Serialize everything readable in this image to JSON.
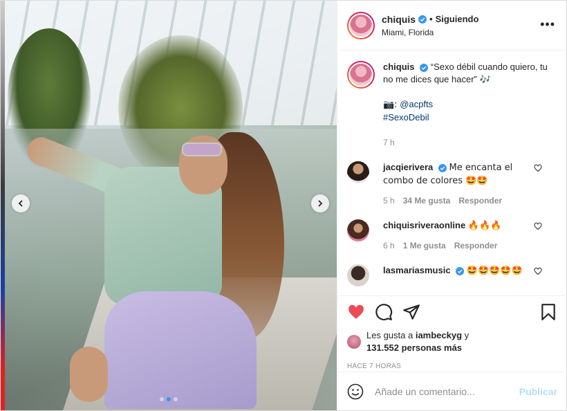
{
  "header": {
    "username": "chiquis",
    "following_label": "Siguiendo",
    "location": "Miami, Florida",
    "more_label": "•••"
  },
  "caption": {
    "username": "chiquis",
    "text": "“Sexo débil cuando quiero, tu no me dices que hacer” 🎶",
    "camera": "📷:",
    "mention": "@acpfts",
    "hashtag": "#SexoDebil",
    "time": "7 h"
  },
  "comments": [
    {
      "username": "jacqierivera",
      "verified": true,
      "text": "Me encanta el combo de colores 🤩🤩",
      "time": "5 h",
      "likes": "34 Me gusta",
      "reply": "Responder"
    },
    {
      "username": "chiquisriveraonline",
      "verified": false,
      "text": "🔥🔥🔥",
      "time": "6 h",
      "likes": "1 Me gusta",
      "reply": "Responder"
    },
    {
      "username": "lasmariasmusic",
      "verified": true,
      "text": "🤩🤩🤩🤩🤩",
      "time": "",
      "likes": "",
      "reply": ""
    }
  ],
  "likes": {
    "prefix": "Les gusta a",
    "user": "iambeckyg",
    "conj": "y",
    "count": "131.552 personas más"
  },
  "ago": "HACE 7 HORAS",
  "add_comment": {
    "placeholder": "Añade un comentario...",
    "publish": "Publicar"
  },
  "colors": {
    "liked_heart": "#ed4956",
    "verified": "#3897f0",
    "publish": "#b2dffc"
  },
  "icons": [
    "chevron-left-icon",
    "chevron-right-icon",
    "heart-icon",
    "comment-icon",
    "share-icon",
    "bookmark-icon",
    "smiley-icon",
    "verified-icon",
    "more-icon"
  ]
}
